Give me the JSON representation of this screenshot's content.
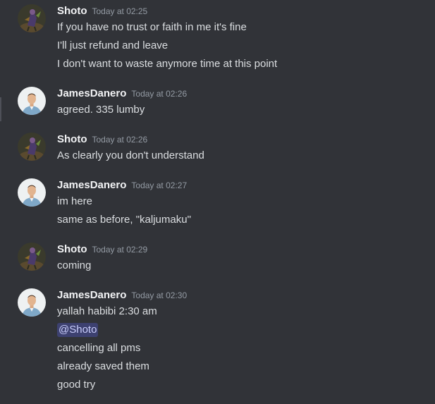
{
  "messages": [
    {
      "author": "Shoto",
      "avatar": "shoto-avatar",
      "timestamp": "Today at 02:25",
      "lines": [
        "If you have no trust or faith in me it's fine",
        "I'll just refund and leave",
        "I don't want to waste anymore time at this point"
      ]
    },
    {
      "author": "JamesDanero",
      "avatar": "james-avatar",
      "timestamp": "Today at 02:26",
      "lines": [
        "agreed. 335 lumby"
      ]
    },
    {
      "author": "Shoto",
      "avatar": "shoto-avatar",
      "timestamp": "Today at 02:26",
      "lines": [
        "As clearly you don't understand"
      ]
    },
    {
      "author": "JamesDanero",
      "avatar": "james-avatar",
      "timestamp": "Today at 02:27",
      "lines": [
        "im here",
        "same as before, \"kaljumaku\""
      ]
    },
    {
      "author": "Shoto",
      "avatar": "shoto-avatar",
      "timestamp": "Today at 02:29",
      "lines": [
        "coming"
      ]
    },
    {
      "author": "JamesDanero",
      "avatar": "james-avatar",
      "timestamp": "Today at 02:30",
      "lines": [
        "yallah habibi 2:30 am",
        "@Shoto",
        "cancelling all pms",
        "already saved them",
        "good try"
      ],
      "mention_line_index": 1
    }
  ],
  "colors": {
    "background": "#313338",
    "username": "#f2f3f5",
    "timestamp": "#949ba4",
    "text": "#dbdee1",
    "mention_bg": "#3c4270",
    "mention_text": "#c9cdfb"
  }
}
